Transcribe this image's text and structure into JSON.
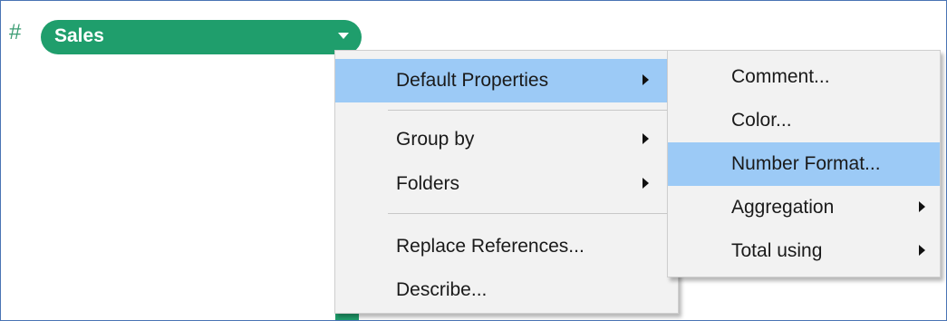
{
  "field_pill": {
    "type_icon": "#",
    "label": "Sales",
    "dropdown_icon": "caret-down-icon"
  },
  "context_menu": {
    "items": [
      {
        "label": "Default Properties",
        "has_submenu": true,
        "highlighted": true
      },
      {
        "label": "Group by",
        "has_submenu": true
      },
      {
        "label": "Folders",
        "has_submenu": true
      },
      {
        "label": "Replace References...",
        "has_submenu": false
      },
      {
        "label": "Describe...",
        "has_submenu": false
      }
    ]
  },
  "submenu": {
    "items": [
      {
        "label": "Comment...",
        "has_submenu": false
      },
      {
        "label": "Color...",
        "has_submenu": false
      },
      {
        "label": "Number Format...",
        "has_submenu": false,
        "highlighted": true
      },
      {
        "label": "Aggregation",
        "has_submenu": true
      },
      {
        "label": "Total using",
        "has_submenu": true
      }
    ]
  },
  "colors": {
    "pill": "#1f9e6c",
    "highlight": "#9ccaf6",
    "menu_background": "#f2f2f2",
    "frame_border": "#4a74b4"
  }
}
